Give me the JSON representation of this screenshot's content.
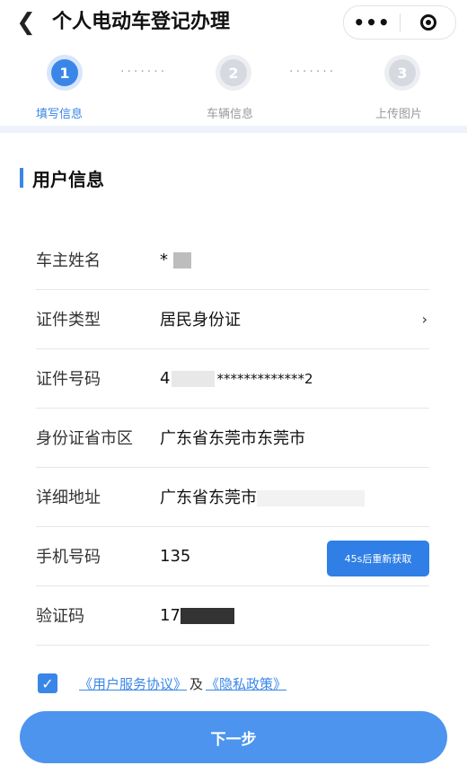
{
  "header": {
    "back_icon": "chevron-left-icon",
    "title": "个人电动车登记办理",
    "more_icon": "more-dots-icon",
    "close_icon": "target-circle-icon"
  },
  "steps": [
    {
      "number": "1",
      "label": "填写信息",
      "state": "active"
    },
    {
      "number": "2",
      "label": "车辆信息",
      "state": "inactive"
    },
    {
      "number": "3",
      "label": "上传图片",
      "state": "inactive"
    }
  ],
  "section": {
    "title": "用户信息"
  },
  "form": {
    "owner_name": {
      "label": "车主姓名",
      "value": "*"
    },
    "id_type": {
      "label": "证件类型",
      "value": "居民身份证"
    },
    "id_number": {
      "label": "证件号码",
      "value_prefix": "4",
      "value_masked": "*************2"
    },
    "id_region": {
      "label": "身份证省市区",
      "value": "广东省东莞市东莞市"
    },
    "address": {
      "label": "详细地址",
      "value": "广东省东莞市"
    },
    "phone": {
      "label": "手机号码",
      "value": "135",
      "sms_button": "45s后重新获取"
    },
    "verify_code": {
      "label": "验证码",
      "value": "17"
    }
  },
  "agreement": {
    "checked": true,
    "service_link": "《用户服务协议》",
    "and_text": "及",
    "privacy_link": "《隐私政策》"
  },
  "next_button": "下一步",
  "colors": {
    "accent": "#3a86e8",
    "button": "#4c94ee"
  }
}
